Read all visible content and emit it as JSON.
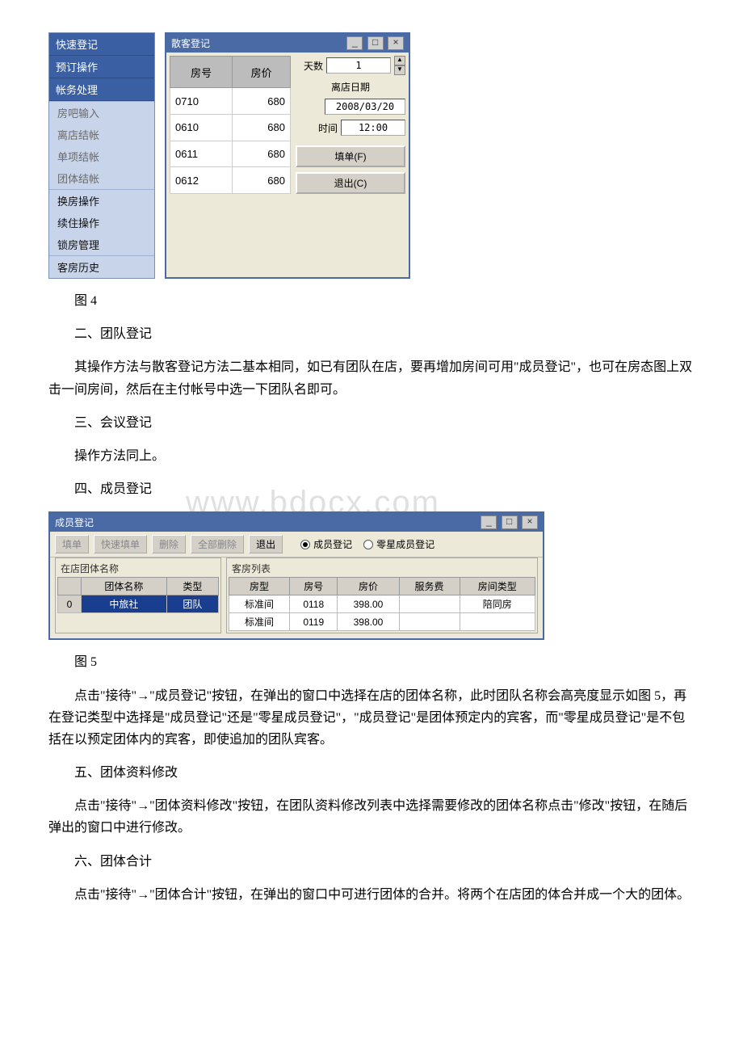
{
  "watermark": "www.bdocx.com",
  "fig4": {
    "sidemenu": {
      "headers": [
        "快速登记",
        "预订操作",
        "帐务处理"
      ],
      "group1": [
        "房吧输入",
        "离店结帐",
        "单项结帐",
        "团体结帐"
      ],
      "group2": [
        "换房操作",
        "续住操作",
        "锁房管理"
      ],
      "group3": [
        "客房历史"
      ]
    },
    "dialog": {
      "title": "散客登记",
      "winbtns": {
        "min": "_",
        "max": "□",
        "close": "×"
      },
      "cols": {
        "room": "房号",
        "price": "房价"
      },
      "rows": [
        {
          "room": "0710",
          "price": "680"
        },
        {
          "room": "0610",
          "price": "680"
        },
        {
          "room": "0611",
          "price": "680"
        },
        {
          "room": "0612",
          "price": "680"
        }
      ],
      "days_label": "天数",
      "days_value": "1",
      "leave_date_label": "离店日期",
      "leave_date_value": "2008/03/20",
      "time_label": "时间",
      "time_value": "12:00",
      "fill_btn": "填单(F)",
      "exit_btn": "退出(C)"
    }
  },
  "caption4": "图 4",
  "sec2_title": "二、团队登记",
  "sec2_body": "其操作方法与散客登记方法二基本相同，如已有团队在店，要再增加房间可用\"成员登记\"，也可在房态图上双击一间房间，然后在主付帐号中选一下团队名即可。",
  "sec3_title": "三、会议登记",
  "sec3_body": "操作方法同上。",
  "sec4_title": "四、成员登记",
  "fig5": {
    "title": "成员登记",
    "winbtns": {
      "min": "_",
      "max": "□",
      "close": "×"
    },
    "toolbar": [
      "填单",
      "快速填单",
      "删除",
      "全部删除",
      "退出"
    ],
    "radio1": "成员登记",
    "radio2": "零星成员登记",
    "left": {
      "caption": "在店团体名称",
      "cols": {
        "name": "团体名称",
        "type": "类型"
      },
      "row": {
        "idx": "0",
        "name": "中旅社",
        "type": "团队"
      }
    },
    "right": {
      "caption": "客房列表",
      "cols": {
        "rt": "房型",
        "rn": "房号",
        "rp": "房价",
        "sv": "服务费",
        "rcat": "房间类型"
      },
      "rows": [
        {
          "rt": "标准间",
          "rn": "0118",
          "rp": "398.00",
          "sv": "",
          "rcat": "陪同房"
        },
        {
          "rt": "标准间",
          "rn": "0119",
          "rp": "398.00",
          "sv": "",
          "rcat": ""
        }
      ]
    }
  },
  "caption5": "图 5",
  "sec4_body": "点击\"接待\"→\"成员登记\"按钮，在弹出的窗口中选择在店的团体名称，此时团队名称会高亮度显示如图 5，再在登记类型中选择是\"成员登记\"还是\"零星成员登记\"，\"成员登记\"是团体预定内的宾客，而\"零星成员登记\"是不包括在以预定团体内的宾客，即使追加的团队宾客。",
  "sec5_title": "五、团体资料修改",
  "sec5_body": "点击\"接待\"→\"团体资料修改\"按钮，在团队资料修改列表中选择需要修改的团体名称点击\"修改\"按钮，在随后弹出的窗口中进行修改。",
  "sec6_title": "六、团体合计",
  "sec6_body": "点击\"接待\"→\"团体合计\"按钮，在弹出的窗口中可进行团体的合并。将两个在店团的体合并成一个大的团体。"
}
